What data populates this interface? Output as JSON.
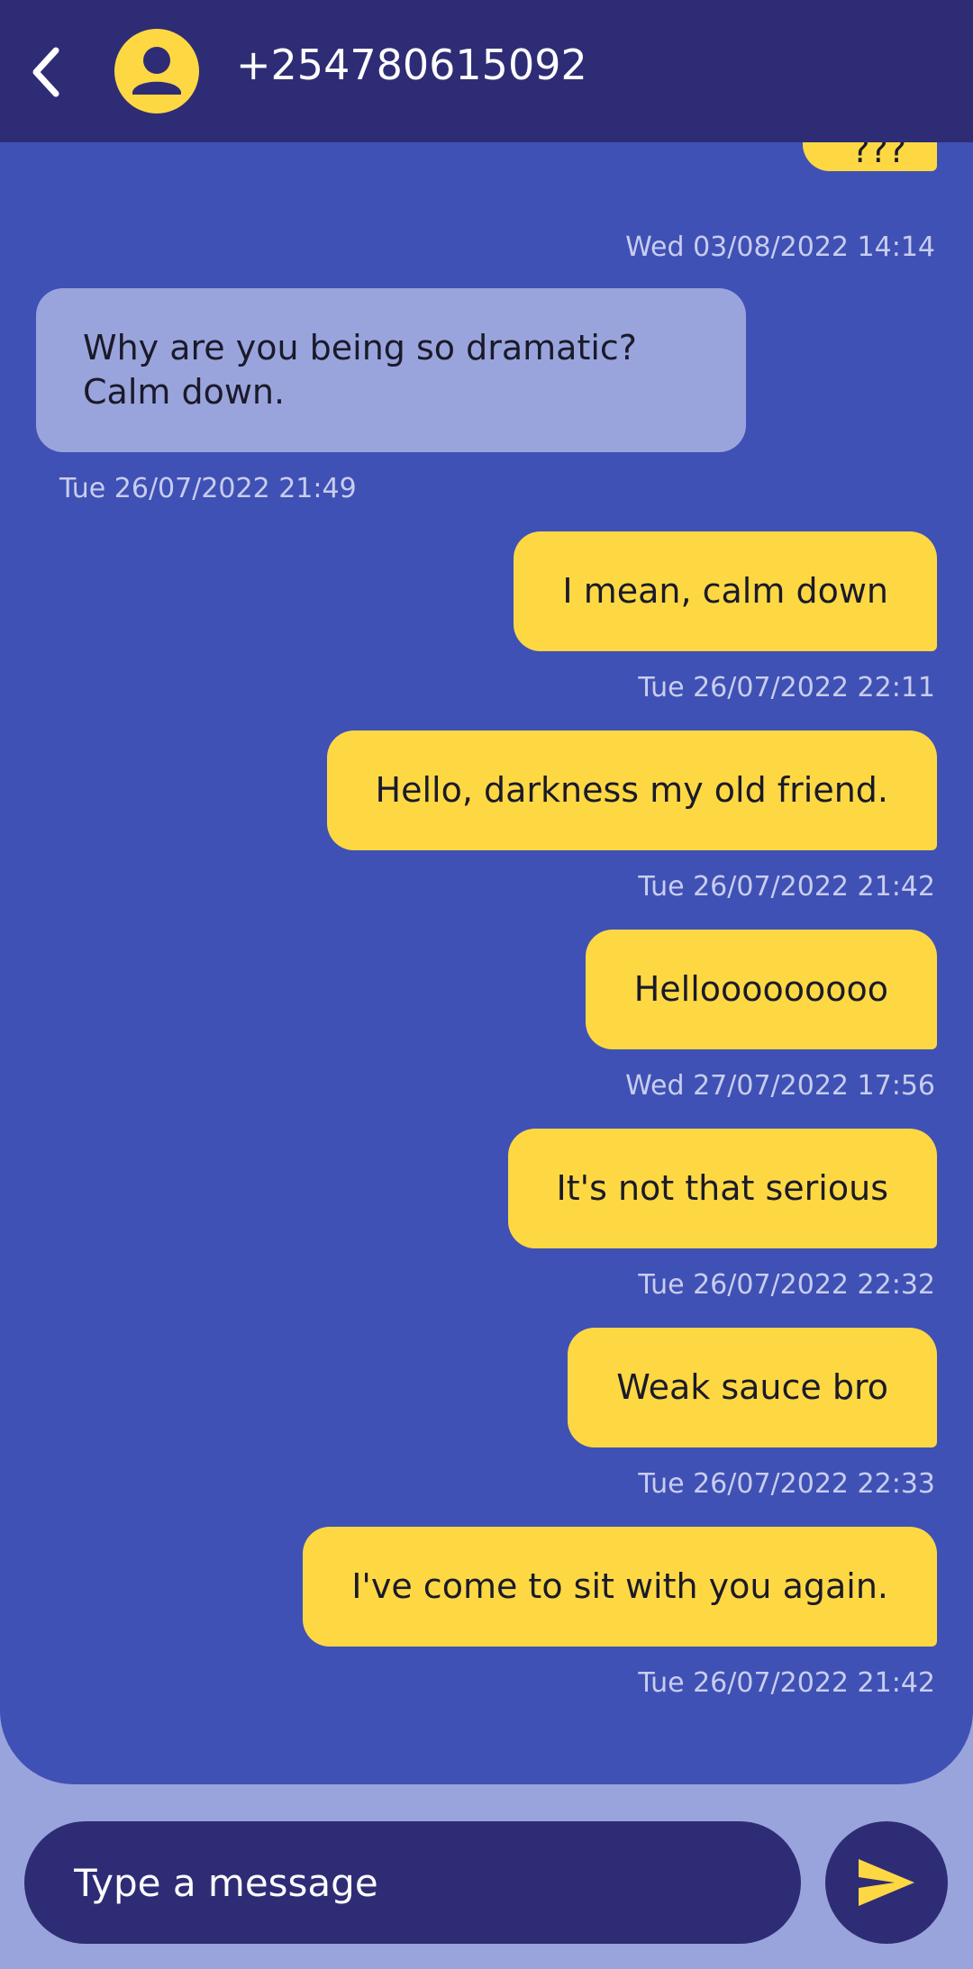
{
  "header": {
    "contact_name": "+254780615092",
    "back_icon": "chevron-left-icon",
    "avatar_icon": "account-circle-icon",
    "background": "#2f2c76"
  },
  "messages": [
    {
      "direction": "sent",
      "text": "???",
      "timestamp": "Wed 03/08/2022 14:14"
    },
    {
      "direction": "received",
      "text": "Why are you being so dramatic?\nCalm down.",
      "timestamp": "Tue 26/07/2022 21:49"
    },
    {
      "direction": "sent",
      "text": "I mean, calm down",
      "timestamp": "Tue 26/07/2022 22:11"
    },
    {
      "direction": "sent",
      "text": "Hello, darkness my old friend.",
      "timestamp": "Tue 26/07/2022 21:42"
    },
    {
      "direction": "sent",
      "text": "Hellooooooooo",
      "timestamp": "Wed 27/07/2022 17:56"
    },
    {
      "direction": "sent",
      "text": "It's not that serious",
      "timestamp": "Tue 26/07/2022 22:32"
    },
    {
      "direction": "sent",
      "text": "Weak sauce bro",
      "timestamp": "Tue 26/07/2022 22:33"
    },
    {
      "direction": "sent",
      "text": "I've come to sit with you again.",
      "timestamp": "Tue 26/07/2022 21:42"
    }
  ],
  "composer": {
    "placeholder": "Type a message",
    "send_icon": "send-icon"
  },
  "colors": {
    "chat_background": "#3f51b5",
    "sent_bubble": "#fed843",
    "received_bubble": "#9aa4dc",
    "page_background": "#9aa4dc",
    "accent": "#fed843"
  }
}
